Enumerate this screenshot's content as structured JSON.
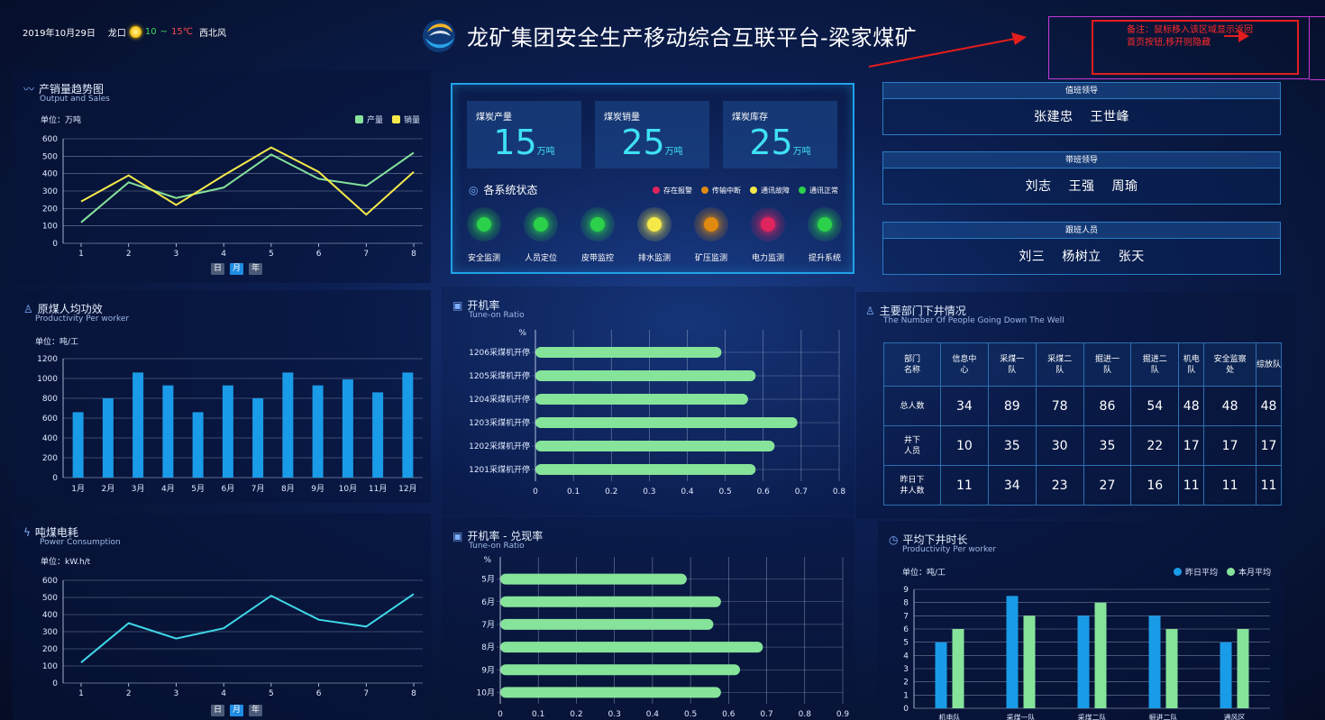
{
  "header": {
    "date": "2019年10月29日",
    "city": "龙口",
    "temp_low": "10",
    "temp_sep": "~",
    "temp_high": "15℃",
    "wind": "西北风",
    "title": "龙矿集团安全生产移动综合互联平台-梁家煤矿"
  },
  "note": {
    "text": "备注：鼠标移入该区域显示返回首页按钮,移开则隐藏"
  },
  "time_tabs": [
    "日",
    "月",
    "年"
  ],
  "output_sales": {
    "title": "产销量趋势图",
    "subtitle": "Output and Sales",
    "unit": "单位：万吨",
    "legend": [
      "产量",
      "销量"
    ]
  },
  "productivity": {
    "title": "原煤人均功效",
    "subtitle": "Productivity Per worker",
    "unit": "单位：吨/工"
  },
  "power": {
    "title": "吨煤电耗",
    "subtitle": "Power Consumption",
    "unit": "单位：kW.h/t"
  },
  "stats": [
    {
      "label": "煤炭产量",
      "value": "15",
      "unit": "万吨"
    },
    {
      "label": "煤炭销量",
      "value": "25",
      "unit": "万吨"
    },
    {
      "label": "煤炭库存",
      "value": "25",
      "unit": "万吨"
    }
  ],
  "system_status": {
    "title": "各系统状态",
    "legend": [
      "存在报警",
      "传输中断",
      "通讯故障",
      "通讯正常"
    ],
    "systems": [
      "安全监测",
      "人员定位",
      "皮带监控",
      "排水监测",
      "矿压监测",
      "电力监测",
      "提升系统"
    ]
  },
  "uptime": {
    "title": "开机率",
    "subtitle": "Tune-on Ratio",
    "axis_unit": "%"
  },
  "uptime_rate": {
    "title": "开机率 - 兑现率",
    "subtitle": "Tune-on Ratio",
    "axis_unit": "%"
  },
  "duty": [
    {
      "heading": "值班领导",
      "names": "张建忠 王世峰"
    },
    {
      "heading": "带班领导",
      "names": "刘志 王强 周瑜"
    },
    {
      "heading": "跟班人员",
      "names": "刘三 杨树立 张天"
    }
  ],
  "dept": {
    "title": "主要部门下井情况",
    "subtitle": "The Number Of People Going Down The Well",
    "corner": "部门名称",
    "columns": [
      "信息中心",
      "采煤一队",
      "采煤二队",
      "掘进一队",
      "掘进二队",
      "机电队",
      "安全监察处",
      "综放队"
    ],
    "rows": [
      {
        "label": "总人数",
        "values": [
          "34",
          "89",
          "78",
          "86",
          "54",
          "48",
          "48",
          "48"
        ]
      },
      {
        "label": "井下人员",
        "values": [
          "10",
          "35",
          "30",
          "35",
          "22",
          "17",
          "17",
          "17"
        ]
      },
      {
        "label": "昨日下井人数",
        "values": [
          "11",
          "34",
          "23",
          "27",
          "16",
          "11",
          "11",
          "11"
        ]
      }
    ]
  },
  "duration": {
    "title": "平均下井时长",
    "subtitle": "Productivity Per worker",
    "unit": "单位：吨/工",
    "legend": [
      "昨日平均",
      "本月平均"
    ]
  },
  "colors": {
    "production": "#86e39a",
    "sales": "#f5e94a",
    "bar_blue": "#1a9be8",
    "bar_green": "#86e39a",
    "line_cyan": "#3fd8e8",
    "alarm": "#e0245e",
    "interrupt": "#e08a12",
    "fault": "#f5e94a",
    "normal": "#2bd14a"
  },
  "chart_data": [
    {
      "type": "line",
      "title": "产销量趋势图",
      "x": [
        1,
        2,
        3,
        4,
        5,
        6,
        7,
        8
      ],
      "series": [
        {
          "name": "产量",
          "values": [
            120,
            350,
            260,
            320,
            510,
            370,
            330,
            520
          ]
        },
        {
          "name": "销量",
          "values": [
            240,
            390,
            220,
            390,
            550,
            410,
            165,
            410
          ]
        }
      ],
      "ylim": [
        0,
        600
      ],
      "yticks": [
        0,
        100,
        200,
        300,
        400,
        500,
        600
      ]
    },
    {
      "type": "bar",
      "title": "原煤人均功效",
      "categories": [
        "1月",
        "2月",
        "3月",
        "4月",
        "5月",
        "6月",
        "7月",
        "8月",
        "9月",
        "10月",
        "11月",
        "12月"
      ],
      "values": [
        660,
        800,
        1060,
        930,
        660,
        930,
        800,
        1060,
        930,
        990,
        860,
        1060
      ],
      "ylim": [
        0,
        1200
      ],
      "yticks": [
        0,
        200,
        400,
        600,
        800,
        1000,
        1200
      ]
    },
    {
      "type": "line",
      "title": "吨煤电耗",
      "x": [
        1,
        2,
        3,
        4,
        5,
        6,
        7,
        8
      ],
      "values": [
        120,
        350,
        260,
        320,
        510,
        370,
        330,
        520
      ],
      "ylim": [
        0,
        600
      ],
      "yticks": [
        0,
        100,
        200,
        300,
        400,
        500,
        600
      ]
    },
    {
      "type": "bar",
      "title": "开机率",
      "orientation": "horizontal",
      "categories": [
        "1206采煤机开停",
        "1205采煤机开停",
        "1204采煤机开停",
        "1203采煤机开停",
        "1202采煤机开停",
        "1201采煤机开停"
      ],
      "values": [
        0.49,
        0.58,
        0.56,
        0.69,
        0.63,
        0.58
      ],
      "xlim": [
        0,
        0.8
      ],
      "xticks": [
        0,
        0.1,
        0.2,
        0.3,
        0.4,
        0.5,
        0.6,
        0.7,
        0.8
      ]
    },
    {
      "type": "bar",
      "title": "开机率 - 兑现率",
      "orientation": "horizontal",
      "categories": [
        "5月",
        "6月",
        "7月",
        "8月",
        "9月",
        "10月"
      ],
      "values": [
        0.49,
        0.58,
        0.56,
        0.69,
        0.63,
        0.58
      ],
      "xlim": [
        0,
        0.9
      ],
      "xticks": [
        0,
        0.1,
        0.2,
        0.3,
        0.4,
        0.5,
        0.6,
        0.7,
        0.8,
        0.9
      ]
    },
    {
      "type": "bar",
      "title": "平均下井时长",
      "categories": [
        "机电队",
        "采煤一队",
        "采煤二队",
        "掘进二队",
        "通风区"
      ],
      "series": [
        {
          "name": "昨日平均",
          "values": [
            5,
            8.5,
            7,
            7,
            5
          ]
        },
        {
          "name": "本月平均",
          "values": [
            6,
            7,
            8,
            6,
            6
          ]
        }
      ],
      "ylim": [
        0,
        9
      ],
      "yticks": [
        0,
        1,
        2,
        3,
        4,
        5,
        6,
        7,
        8,
        9
      ]
    }
  ]
}
